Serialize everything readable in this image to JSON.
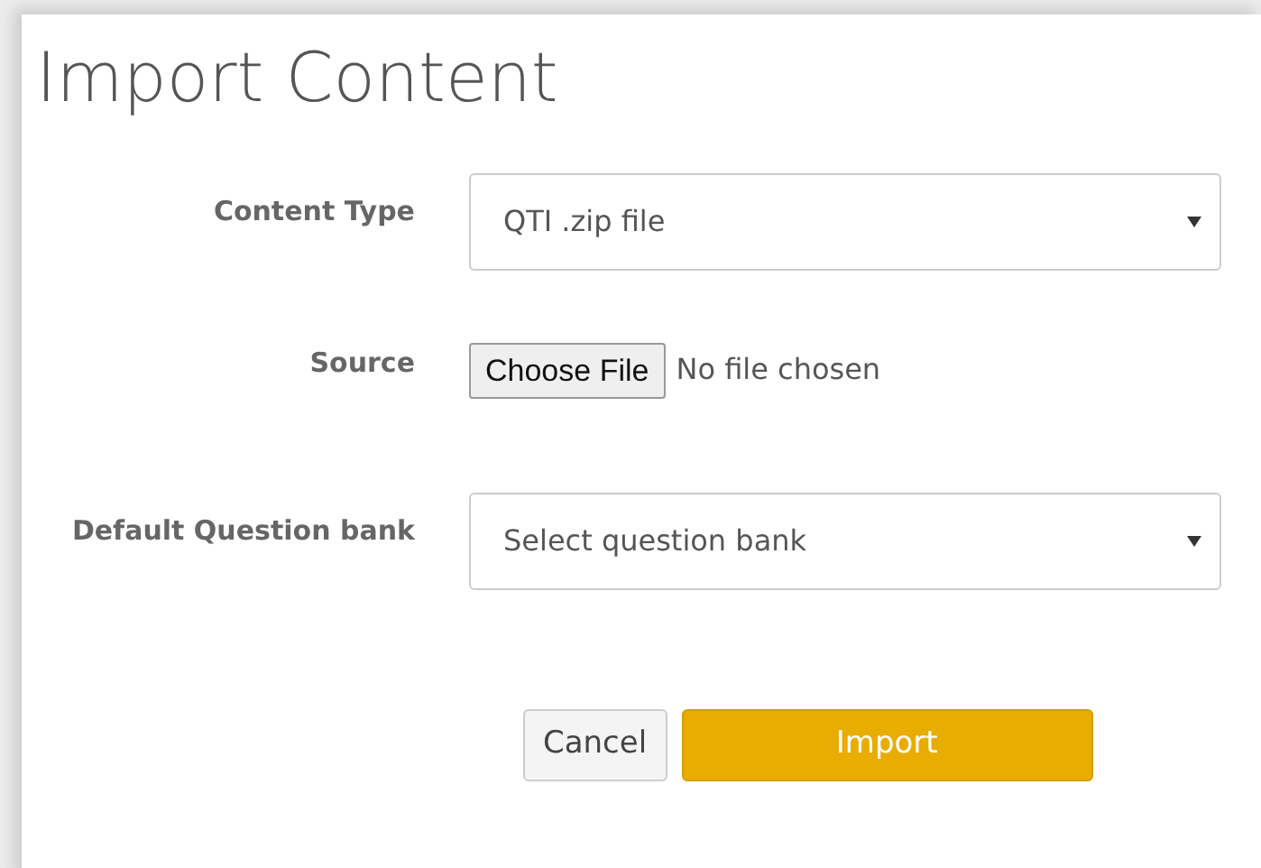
{
  "title": "Import Content",
  "fields": [
    {
      "kind": "select",
      "label": "Content Type",
      "value": "QTI .zip file"
    },
    {
      "kind": "file",
      "label": "Source",
      "button": "Choose File",
      "status": "No file chosen"
    },
    {
      "kind": "select",
      "label": "Default Question bank",
      "placeholder": "Select question bank"
    }
  ],
  "buttons": [
    {
      "label": "Cancel",
      "kind": "secondary"
    },
    {
      "label": "Import",
      "kind": "primary"
    }
  ]
}
